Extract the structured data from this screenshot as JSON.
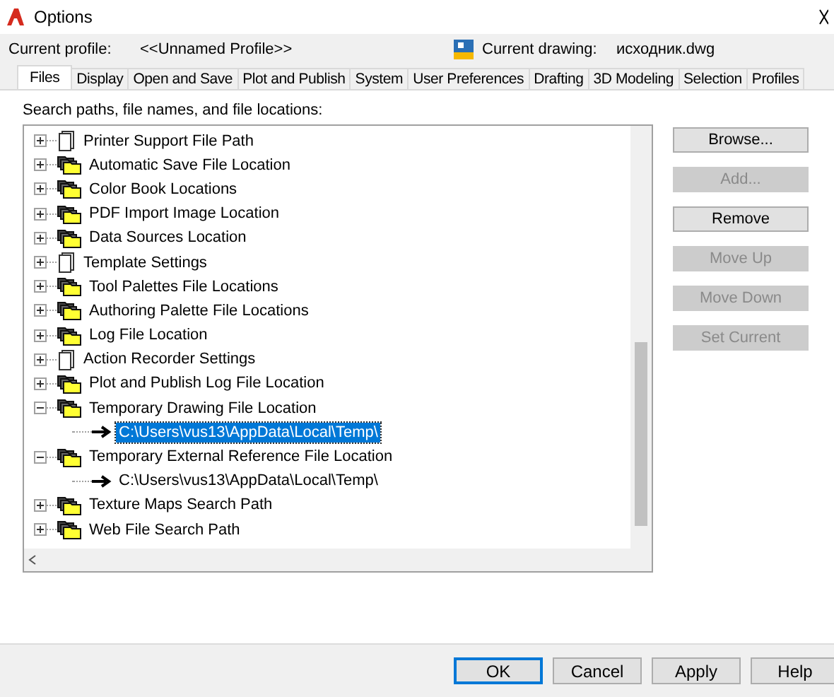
{
  "window": {
    "title": "Options"
  },
  "profile": {
    "label": "Current profile:",
    "value": "<<Unnamed Profile>>"
  },
  "drawing": {
    "label": "Current drawing:",
    "value": "исходник.dwg"
  },
  "tabs": [
    {
      "label": "Files",
      "selected": true
    },
    {
      "label": "Display",
      "selected": false
    },
    {
      "label": "Open and Save",
      "selected": false
    },
    {
      "label": "Plot and Publish",
      "selected": false
    },
    {
      "label": "System",
      "selected": false
    },
    {
      "label": "User Preferences",
      "selected": false
    },
    {
      "label": "Drafting",
      "selected": false
    },
    {
      "label": "3D Modeling",
      "selected": false
    },
    {
      "label": "Selection",
      "selected": false
    },
    {
      "label": "Profiles",
      "selected": false
    }
  ],
  "tree_label": "Search paths, file names, and file locations:",
  "tree": [
    {
      "label": "Printer Support File Path",
      "kind": "document",
      "expanded": false
    },
    {
      "label": "Automatic Save File Location",
      "kind": "folder",
      "expanded": false
    },
    {
      "label": "Color Book Locations",
      "kind": "folder",
      "expanded": false
    },
    {
      "label": "PDF Import Image Location",
      "kind": "folder",
      "expanded": false
    },
    {
      "label": "Data Sources Location",
      "kind": "folder",
      "expanded": false
    },
    {
      "label": "Template Settings",
      "kind": "document",
      "expanded": false
    },
    {
      "label": "Tool Palettes File Locations",
      "kind": "folder",
      "expanded": false
    },
    {
      "label": "Authoring Palette File Locations",
      "kind": "folder",
      "expanded": false
    },
    {
      "label": "Log File Location",
      "kind": "folder",
      "expanded": false
    },
    {
      "label": "Action Recorder Settings",
      "kind": "document",
      "expanded": false
    },
    {
      "label": "Plot and Publish Log File Location",
      "kind": "folder",
      "expanded": false
    },
    {
      "label": "Temporary Drawing File Location",
      "kind": "folder",
      "expanded": true,
      "children": [
        {
          "label": "C:\\Users\\vus13\\AppData\\Local\\Temp\\",
          "selected": true
        }
      ]
    },
    {
      "label": "Temporary External Reference File Location",
      "kind": "folder",
      "expanded": true,
      "children": [
        {
          "label": "C:\\Users\\vus13\\AppData\\Local\\Temp\\",
          "selected": false
        }
      ]
    },
    {
      "label": "Texture Maps Search Path",
      "kind": "folder",
      "expanded": false
    },
    {
      "label": "Web File Search Path",
      "kind": "folder",
      "expanded": false
    }
  ],
  "side_buttons": [
    {
      "label": "Browse...",
      "disabled": false
    },
    {
      "label": "Add...",
      "disabled": true
    },
    {
      "label": "Remove",
      "disabled": false
    },
    {
      "label": "Move Up",
      "disabled": true
    },
    {
      "label": "Move Down",
      "disabled": true
    },
    {
      "label": "Set Current",
      "disabled": true
    }
  ],
  "footer_buttons": [
    {
      "label": "OK",
      "default": true
    },
    {
      "label": "Cancel",
      "default": false
    },
    {
      "label": "Apply",
      "default": false
    },
    {
      "label": "Help",
      "default": false
    }
  ]
}
